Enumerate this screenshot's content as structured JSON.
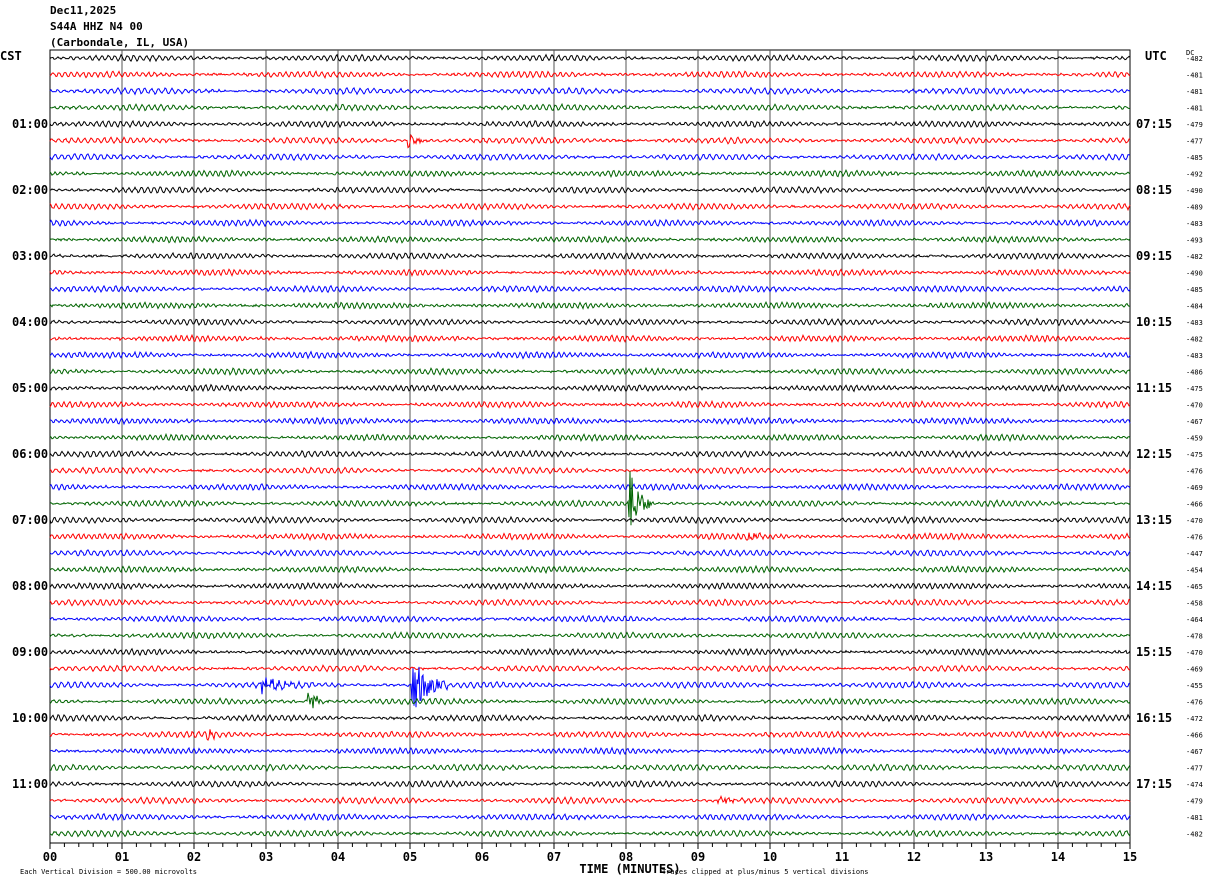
{
  "header": {
    "date": "Dec11,2025",
    "station": "S44A HHZ N4 00",
    "location": "(Carbondale, IL, USA)"
  },
  "chart_data": {
    "type": "line",
    "subtype": "helicorder",
    "xlabel": "TIME (MINUTES)",
    "x_ticks": [
      "00",
      "01",
      "02",
      "03",
      "04",
      "05",
      "06",
      "07",
      "08",
      "09",
      "10",
      "11",
      "12",
      "13",
      "14",
      "15"
    ],
    "xlim": [
      0,
      15
    ],
    "grid": true,
    "left_axis_title": "CST",
    "right_axis_title": "UTC",
    "dc_title": "DC",
    "left_time_labels": [
      "",
      "01:00",
      "02:00",
      "03:00",
      "04:00",
      "05:00",
      "06:00",
      "07:00",
      "08:00",
      "09:00",
      "10:00",
      "11:00"
    ],
    "right_time_labels": [
      "",
      "07:15",
      "08:15",
      "09:15",
      "10:15",
      "11:15",
      "12:15",
      "13:15",
      "14:15",
      "15:15",
      "16:15",
      "17:15"
    ],
    "trace_colors": [
      "#000000",
      "#ff0000",
      "#0000ff",
      "#006400"
    ],
    "dc_offsets": [
      -482,
      -481,
      -481,
      -481,
      -479,
      -477,
      -485,
      -492,
      -490,
      -489,
      -483,
      -493,
      -482,
      -490,
      -485,
      -484,
      -483,
      -482,
      -483,
      -486,
      -475,
      -470,
      -467,
      -459,
      -475,
      -476,
      -469,
      -466,
      -470,
      -476,
      -447,
      -454,
      -465,
      -458,
      -464,
      -478,
      -470,
      -469,
      -455,
      -476,
      -472,
      -466,
      -467,
      -477,
      -474,
      -479,
      -481,
      -482
    ],
    "events": [
      {
        "trace": 27,
        "minute": 8.05,
        "amplitude": 5,
        "duration": 0.3
      },
      {
        "trace": 38,
        "minute": 5.05,
        "amplitude": 3.5,
        "duration": 0.5
      },
      {
        "trace": 38,
        "minute": 2.95,
        "amplitude": 1,
        "duration": 0.8
      },
      {
        "trace": 39,
        "minute": 3.6,
        "amplitude": 1.5,
        "duration": 0.3
      },
      {
        "trace": 41,
        "minute": 2.2,
        "amplitude": 0.6,
        "duration": 0.2
      },
      {
        "trace": 5,
        "minute": 5.0,
        "amplitude": 0.8,
        "duration": 0.3
      },
      {
        "trace": 45,
        "minute": 9.3,
        "amplitude": 0.6,
        "duration": 0.4
      },
      {
        "trace": 29,
        "minute": 9.7,
        "amplitude": 0.6,
        "duration": 0.3
      }
    ]
  },
  "footer": {
    "scale_note": "Each Vertical Division =  500.00 microvolts",
    "clip_note": "Traces clipped at plus/minus 5 vertical divisions"
  }
}
